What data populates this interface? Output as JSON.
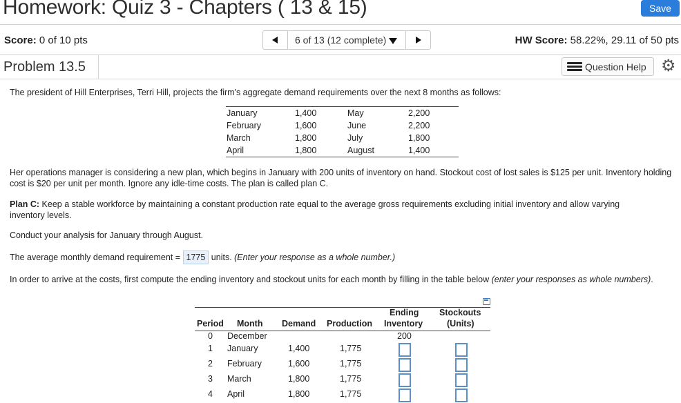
{
  "header": {
    "title": "Homework: Quiz 3 - Chapters ( 13 & 15)",
    "save_label": "Save"
  },
  "scorebar": {
    "score_label": "Score:",
    "score_value": " 0 of 10 pts",
    "nav_text": "6 of 13 (12 complete)",
    "hw_score_label": "HW Score:",
    "hw_score_value": " 58.22%, 29.11 of 50 pts"
  },
  "problem": {
    "title": "Problem 13.5",
    "help_label": "Question Help"
  },
  "question": {
    "intro": "The president of Hill Enterprises, Terri Hill, projects the firm's aggregate demand requirements over the next 8 months as follows:",
    "demand_table": [
      {
        "month1": "January",
        "value1": "1,400",
        "month2": "May",
        "value2": "2,200"
      },
      {
        "month1": "February",
        "value1": "1,600",
        "month2": "June",
        "value2": "2,200"
      },
      {
        "month1": "March",
        "value1": "1,800",
        "month2": "July",
        "value2": "1,800"
      },
      {
        "month1": "April",
        "value1": "1,800",
        "month2": "August",
        "value2": "1,400"
      }
    ],
    "scenario": "Her operations manager is considering a new plan, which begins in January with 200 units of inventory on hand. Stockout cost of lost sales is $125 per unit. Inventory holding cost is $20 per unit per month. Ignore any idle-time costs. The plan is called plan C.",
    "plan_label": "Plan C:",
    "plan_text": " Keep a stable workforce by maintaining a constant production rate equal to the average gross requirements excluding initial inventory and allow varying inventory levels.",
    "conduct": "Conduct your analysis for January through August.",
    "avg_prefix": "The average monthly demand requirement = ",
    "avg_value": "1775",
    "avg_units": " units. ",
    "avg_hint": "(Enter your response as a whole number.)",
    "instruction": "In order to arrive at the costs, first compute the ending inventory and stockout units for each month by filling in the table below ",
    "instruction_hint": "(enter your responses as whole numbers)",
    "instruction_end": "."
  },
  "analysis_table": {
    "headers": {
      "period": "Period",
      "month": "Month",
      "demand": "Demand",
      "production": "Production",
      "ending_1": "Ending",
      "ending_2": "Inventory",
      "stockouts_1": "Stockouts",
      "stockouts_2": "(Units)"
    },
    "rows": [
      {
        "period": "0",
        "month": "December",
        "demand": "",
        "production": "",
        "ending": "200"
      },
      {
        "period": "1",
        "month": "January",
        "demand": "1,400",
        "production": "1,775",
        "ending": ""
      },
      {
        "period": "2",
        "month": "February",
        "demand": "1,600",
        "production": "1,775",
        "ending": ""
      },
      {
        "period": "3",
        "month": "March",
        "demand": "1,800",
        "production": "1,775",
        "ending": ""
      },
      {
        "period": "4",
        "month": "April",
        "demand": "1,800",
        "production": "1,775",
        "ending": ""
      }
    ]
  },
  "colors": {
    "save_button": "#2a7ddb",
    "input_border": "#5a8fc8",
    "answer_highlight": "#e8f1fb"
  }
}
